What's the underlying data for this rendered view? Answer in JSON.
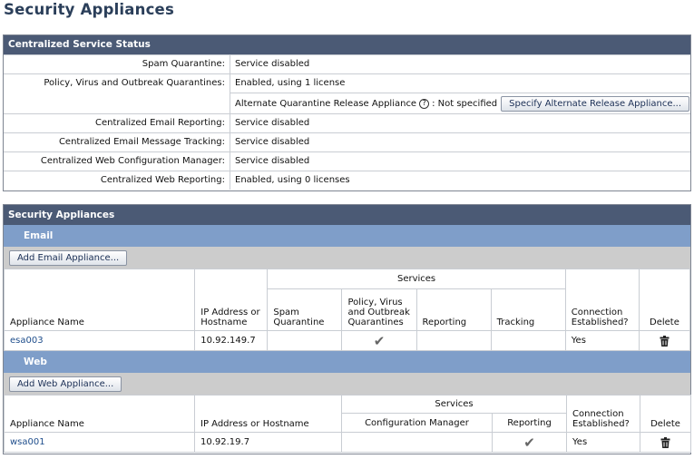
{
  "page_title": "Security Appliances",
  "status": {
    "header": "Centralized Service Status",
    "rows": [
      {
        "label": "Spam Quarantine:",
        "value": "Service disabled"
      },
      {
        "label": "Policy, Virus and Outbreak Quarantines:",
        "value": "Enabled, using 1 license"
      },
      {
        "label": "Centralized Email Reporting:",
        "value": "Service disabled"
      },
      {
        "label": "Centralized Email Message Tracking:",
        "value": "Service disabled"
      },
      {
        "label": "Centralized Web Configuration Manager:",
        "value": "Service disabled"
      },
      {
        "label": "Centralized Web Reporting:",
        "value": "Enabled, using 0 licenses"
      }
    ],
    "alt_release_label": "Alternate Quarantine Release Appliance",
    "alt_release_value": ": Not specified",
    "alt_release_button": "Specify Alternate Release Appliance...",
    "help_glyph": "?"
  },
  "appliances": {
    "header": "Security Appliances",
    "email": {
      "section": "Email",
      "add_button": "Add Email Appliance...",
      "columns": {
        "name": "Appliance Name",
        "ip": "IP Address or Hostname",
        "services": "Services",
        "spam": "Spam Quarantine",
        "pvo": "Policy, Virus and Outbreak Quarantines",
        "reporting": "Reporting",
        "tracking": "Tracking",
        "connection": "Connection Established?",
        "delete": "Delete"
      },
      "rows": [
        {
          "name": "esa003",
          "ip": "10.92.149.7",
          "spam": "",
          "pvo": "✔",
          "reporting": "",
          "tracking": "",
          "connection": "Yes"
        }
      ]
    },
    "web": {
      "section": "Web",
      "add_button": "Add Web Appliance...",
      "columns": {
        "name": "Appliance Name",
        "ip": "IP Address or Hostname",
        "services": "Services",
        "config": "Configuration Manager",
        "reporting": "Reporting",
        "connection": "Connection Established?",
        "delete": "Delete"
      },
      "rows": [
        {
          "name": "wsa001",
          "ip": "10.92.19.7",
          "config": "",
          "reporting": "✔",
          "connection": "Yes"
        }
      ]
    }
  },
  "icons": {
    "help": "help-icon",
    "trash": "trash-icon",
    "check": "checkmark-icon"
  }
}
